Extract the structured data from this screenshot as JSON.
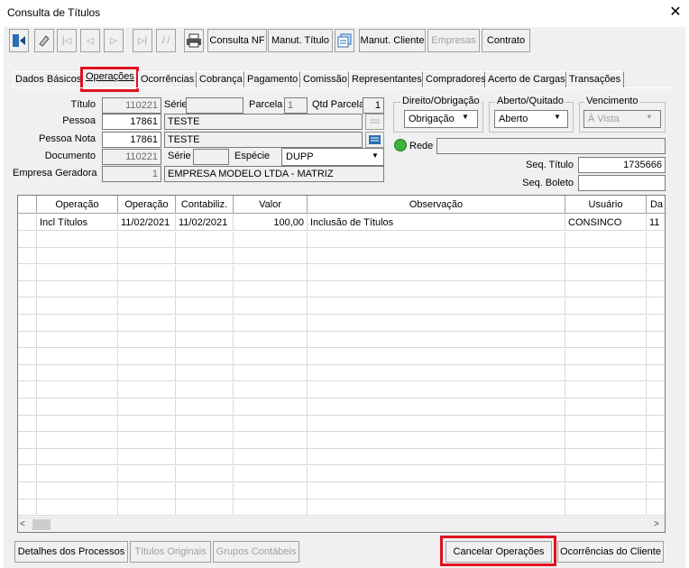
{
  "window": {
    "title": "Consulta de Títulos",
    "close": "✕"
  },
  "toolbar": {
    "consulta_nf": "Consulta NF",
    "manut_titulo": "Manut. Título",
    "manut_cliente": "Manut. Cliente",
    "empresas": "Empresas",
    "contrato": "Contrato"
  },
  "tabs": [
    "Dados Básicos",
    "Operações",
    "Ocorrências",
    "Cobrança",
    "Pagamento",
    "Comissão",
    "Representantes",
    "Compradores",
    "Acerto de Cargas",
    "Transações"
  ],
  "form": {
    "titulo_label": "Título",
    "titulo_value": "110221",
    "serie_label": "Série",
    "serie_value": "",
    "parcela_label": "Parcela",
    "parcela_value": "1",
    "qtd_parcela_label": "Qtd Parcela",
    "qtd_parcela_value": "1",
    "pessoa_label": "Pessoa",
    "pessoa_code": "17861",
    "pessoa_name": "TESTE",
    "pessoa_nota_label": "Pessoa Nota",
    "pessoa_nota_code": "17861",
    "pessoa_nota_name": "TESTE",
    "documento_label": "Documento",
    "documento_value": "110221",
    "serie2_label": "Série",
    "serie2_value": "",
    "especie_label": "Espécie",
    "especie_value": "DUPP",
    "empresa_label": "Empresa Geradora",
    "empresa_code": "1",
    "empresa_name": "EMPRESA MODELO LTDA - MATRIZ",
    "direito_label": "Direito/Obrigação",
    "direito_value": "Obrigação",
    "aberto_label": "Aberto/Quitado",
    "aberto_value": "Aberto",
    "vencimento_label": "Vencimento",
    "vencimento_value": "À Vista",
    "rede_label": "Rede",
    "rede_value": "",
    "seq_titulo_label": "Seq. Título",
    "seq_titulo_value": "1735666",
    "seq_boleto_label": "Seq. Boleto",
    "seq_boleto_value": ""
  },
  "grid": {
    "columns": [
      "Operação",
      "Operação",
      "Contabiliz.",
      "Valor",
      "Observação",
      "Usuário",
      "Da"
    ],
    "rows": [
      [
        "Incl Títulos",
        "11/02/2021",
        "11/02/2021",
        "100,00",
        "Inclusão de Títulos",
        "CONSINCO",
        "11"
      ]
    ]
  },
  "buttons": {
    "detalhes": "Detalhes dos Processos",
    "titulos_originais": "Títulos Originais",
    "grupos_contabeis": "Grupos Contábeis",
    "cancelar_operacoes": "Cancelar Operações",
    "ocorrencias_cliente": "Ocorrências do Cliente"
  },
  "colors": {
    "highlight": "#e01020",
    "panel": "#f0f0f0"
  }
}
